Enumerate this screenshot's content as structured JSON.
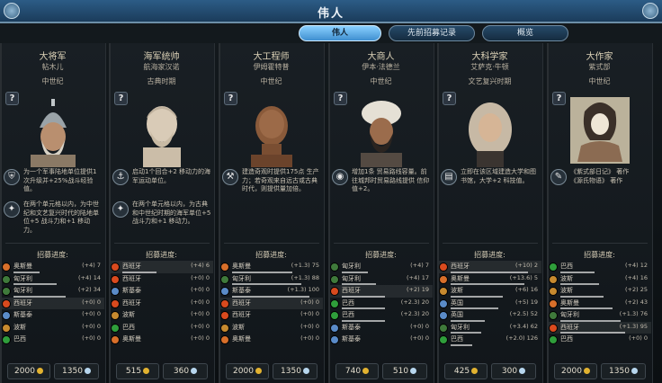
{
  "window": {
    "title": "伟人"
  },
  "tabs": [
    {
      "label": "伟人",
      "active": true
    },
    {
      "label": "先前招募记录",
      "active": false
    },
    {
      "label": "概览",
      "active": false
    }
  ],
  "colors": {
    "title_bar": "#234b6e",
    "tab_active": "#6fbef5",
    "progress_gold": "#e2b230",
    "progress_culture": "#b7d6ee"
  },
  "columns": [
    {
      "type": "大将军",
      "name": "帖木儿",
      "era": "中世纪",
      "help_icon": "?",
      "portrait_icon": "general-helmet-portrait",
      "abilities": [
        {
          "icon": "shield-icon",
          "text": "为一个军事陆地单位提供1次升级并+25%战斗经验值。"
        },
        {
          "icon": "star-icon",
          "text": "在两个单元格以内，为中世纪和文艺复兴时代的陆地单位+5 战斗力和+1 移动力。"
        }
      ],
      "progress_title": "招募进度:",
      "recruit": [
        {
          "civ": "奥斯曼",
          "val": "(+4) 7",
          "color": "#d86f2a",
          "fill": 0.3
        },
        {
          "civ": "匈牙利",
          "val": "(+4) 14",
          "color": "#3f7a3b",
          "fill": 0.5
        },
        {
          "civ": "匈牙利",
          "val": "(+2) 34",
          "color": "#3f7a3b",
          "fill": 0.6
        },
        {
          "civ": "西班牙",
          "val": "(+0) 0",
          "color": "#d94a1e",
          "fill": 0.0,
          "me": true
        },
        {
          "civ": "斯基泰",
          "val": "(+0) 0",
          "color": "#5a8bc8",
          "fill": 0.0
        },
        {
          "civ": "波斯",
          "val": "(+0) 0",
          "color": "#c78a2f",
          "fill": 0.0
        },
        {
          "civ": "巴西",
          "val": "(+0) 0",
          "color": "#2f9e3b",
          "fill": 0.0
        }
      ],
      "cost_gold": "2000",
      "cost_faith": "1350"
    },
    {
      "type": "海军统帅",
      "name": "航海家汉诺",
      "era": "古典时期",
      "help_icon": "?",
      "portrait_icon": "admiral-bust-portrait",
      "abilities": [
        {
          "icon": "anchor-icon",
          "text": "启动1个回合+2 移动力的海军运动单位。"
        },
        {
          "icon": "star-icon",
          "text": "在两个单元格以内，为古典和中世纪时期的海军单位+5 战斗力和+1 移动力。"
        }
      ],
      "progress_title": "招募进度:",
      "recruit": [
        {
          "civ": "西班牙",
          "val": "(+4) 6",
          "color": "#d94a1e",
          "fill": 0.4,
          "me": true
        },
        {
          "civ": "西班牙",
          "val": "(+0) 0",
          "color": "#d94a1e",
          "fill": 0.0
        },
        {
          "civ": "斯基泰",
          "val": "(+0) 0",
          "color": "#5a8bc8",
          "fill": 0.0
        },
        {
          "civ": "西班牙",
          "val": "(+0) 0",
          "color": "#d94a1e",
          "fill": 0.0
        },
        {
          "civ": "波斯",
          "val": "(+0) 0",
          "color": "#c78a2f",
          "fill": 0.0
        },
        {
          "civ": "巴西",
          "val": "(+0) 0",
          "color": "#2f9e3b",
          "fill": 0.0
        },
        {
          "civ": "奥斯曼",
          "val": "(+0) 0",
          "color": "#d86f2a",
          "fill": 0.0
        }
      ],
      "cost_gold": "515",
      "cost_faith": "360"
    },
    {
      "type": "大工程师",
      "name": "伊姆霍特普",
      "era": "中世纪",
      "help_icon": "?",
      "portrait_icon": "engineer-bust-portrait",
      "abilities": [
        {
          "icon": "hammer-icon",
          "text": "建造奇观时提供175点 生产力；若奇观来自远古或古典时代，则提供量加倍。"
        }
      ],
      "progress_title": "招募进度:",
      "recruit": [
        {
          "civ": "奥斯曼",
          "val": "(+1.3) 75",
          "color": "#d86f2a",
          "fill": 0.7
        },
        {
          "civ": "匈牙利",
          "val": "(+1.3) 88",
          "color": "#3f7a3b",
          "fill": 0.8
        },
        {
          "civ": "斯基泰",
          "val": "(+1.3) 100",
          "color": "#5a8bc8",
          "fill": 0.9
        },
        {
          "civ": "西班牙",
          "val": "(+0) 0",
          "color": "#d94a1e",
          "fill": 0.0,
          "me": true
        },
        {
          "civ": "西班牙",
          "val": "(+0) 0",
          "color": "#d94a1e",
          "fill": 0.0
        },
        {
          "civ": "波斯",
          "val": "(+0) 0",
          "color": "#c78a2f",
          "fill": 0.0
        },
        {
          "civ": "奥斯曼",
          "val": "(+0) 0",
          "color": "#d86f2a",
          "fill": 0.0
        }
      ],
      "cost_gold": "2000",
      "cost_faith": "1350"
    },
    {
      "type": "大商人",
      "name": "伊本·法德兰",
      "era": "中世纪",
      "help_icon": "?",
      "portrait_icon": "merchant-turban-portrait",
      "abilities": [
        {
          "icon": "coin-icon",
          "text": "增加1条 贸易路线容量。前往城邦时贸易路线提供 信仰值+2。"
        }
      ],
      "progress_title": "招募进度:",
      "recruit": [
        {
          "civ": "匈牙利",
          "val": "(+4) 7",
          "color": "#3f7a3b",
          "fill": 0.3
        },
        {
          "civ": "匈牙利",
          "val": "(+4) 17",
          "color": "#3f7a3b",
          "fill": 0.4
        },
        {
          "civ": "西班牙",
          "val": "(+2) 19",
          "color": "#d94a1e",
          "fill": 0.5,
          "me": true
        },
        {
          "civ": "巴西",
          "val": "(+2.3) 20",
          "color": "#2f9e3b",
          "fill": 0.5
        },
        {
          "civ": "巴西",
          "val": "(+2.3) 20",
          "color": "#2f9e3b",
          "fill": 0.5
        },
        {
          "civ": "斯基泰",
          "val": "(+0) 0",
          "color": "#5a8bc8",
          "fill": 0.0
        },
        {
          "civ": "斯基泰",
          "val": "(+0) 0",
          "color": "#5a8bc8",
          "fill": 0.0
        }
      ],
      "cost_gold": "740",
      "cost_faith": "510"
    },
    {
      "type": "大科学家",
      "name": "艾萨克·牛顿",
      "era": "文艺复兴时期",
      "help_icon": "?",
      "portrait_icon": "scientist-wig-portrait",
      "abilities": [
        {
          "icon": "book-icon",
          "text": "立即在该区域建造大学和图书馆，大学+2 科技值。"
        }
      ],
      "progress_title": "招募进度:",
      "recruit": [
        {
          "civ": "西班牙",
          "val": "(+10) 2",
          "color": "#d94a1e",
          "fill": 0.9,
          "me": true
        },
        {
          "civ": "奥斯曼",
          "val": "(+13.6) 5",
          "color": "#d86f2a",
          "fill": 0.85
        },
        {
          "civ": "波斯",
          "val": "(+6) 16",
          "color": "#c78a2f",
          "fill": 0.6
        },
        {
          "civ": "英国",
          "val": "(+5) 19",
          "color": "#5a8bc8",
          "fill": 0.55
        },
        {
          "civ": "英国",
          "val": "(+2.5) 52",
          "color": "#5a8bc8",
          "fill": 0.4
        },
        {
          "civ": "匈牙利",
          "val": "(+3.4) 62",
          "color": "#3f7a3b",
          "fill": 0.35
        },
        {
          "civ": "巴西",
          "val": "(+2.0) 126",
          "color": "#2f9e3b",
          "fill": 0.25
        }
      ],
      "cost_gold": "425",
      "cost_faith": "300"
    },
    {
      "type": "大作家",
      "name": "紫式部",
      "era": "中世纪",
      "help_icon": "?",
      "portrait_icon": "writer-ink-portrait",
      "abilities": [
        {
          "icon": "quill-icon",
          "text": "《紫式部日记》 著作\n《源氏物语》 著作"
        }
      ],
      "progress_title": "招募进度:",
      "recruit": [
        {
          "civ": "巴西",
          "val": "(+4) 12",
          "color": "#2f9e3b",
          "fill": 0.4
        },
        {
          "civ": "波斯",
          "val": "(+4) 16",
          "color": "#c78a2f",
          "fill": 0.45
        },
        {
          "civ": "波斯",
          "val": "(+2) 25",
          "color": "#c78a2f",
          "fill": 0.5
        },
        {
          "civ": "奥斯曼",
          "val": "(+2) 43",
          "color": "#d86f2a",
          "fill": 0.6
        },
        {
          "civ": "匈牙利",
          "val": "(+1.3) 76",
          "color": "#3f7a3b",
          "fill": 0.7
        },
        {
          "civ": "西班牙",
          "val": "(+1.3) 95",
          "color": "#d94a1e",
          "fill": 0.75,
          "me": true
        },
        {
          "civ": "巴西",
          "val": "(+0) 0",
          "color": "#2f9e3b",
          "fill": 0.0
        }
      ],
      "cost_gold": "2000",
      "cost_faith": "1350"
    }
  ]
}
